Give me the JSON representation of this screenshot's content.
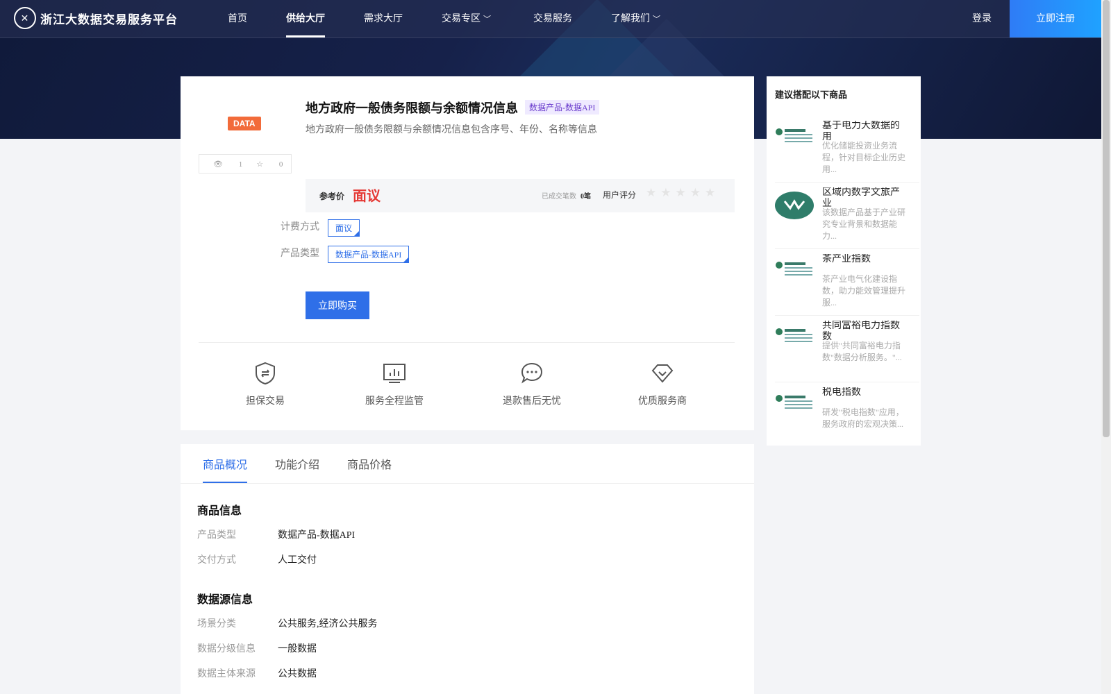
{
  "nav": {
    "logo_text": "浙江大数据交易服务平台",
    "items": [
      "首页",
      "供给大厅",
      "需求大厅",
      "交易专区",
      "交易服务",
      "了解我们"
    ],
    "login": "登录",
    "register": "立即注册"
  },
  "product": {
    "badge": "DATA",
    "views": "1",
    "favorites": "0",
    "title": "地方政府一般债务限额与余额情况信息",
    "title_tag": "数据产品-数据API",
    "subtitle": "地方政府一般债务限额与余额情况信息包含序号、年份、名称等信息",
    "price_label": "参考价",
    "price_value": "面议",
    "deals_label": "已成交笔数",
    "deals_value": "0笔",
    "rating_label": "用户评分",
    "rating_stars": 0,
    "billing_label": "计费方式",
    "billing_value": "面议",
    "type_label": "产品类型",
    "type_value": "数据产品-数据API",
    "buy_button": "立即购买"
  },
  "features": [
    "担保交易",
    "服务全程监管",
    "退款售后无忧",
    "优质服务商"
  ],
  "tabs": [
    "商品概况",
    "功能介绍",
    "商品价格"
  ],
  "info": {
    "section1_title": "商品信息",
    "section1": [
      {
        "label": "产品类型",
        "value": "数据产品-数据API"
      },
      {
        "label": "交付方式",
        "value": "人工交付"
      }
    ],
    "section2_title": "数据源信息",
    "section2": [
      {
        "label": "场景分类",
        "value": "公共服务,经济公共服务"
      },
      {
        "label": "数据分级信息",
        "value": "一般数据"
      },
      {
        "label": "数据主体来源",
        "value": "公共数据"
      }
    ]
  },
  "sidebar": {
    "title": "建议搭配以下商品",
    "items": [
      {
        "name": "基于电力大数据的用",
        "desc": "优化储能投资业务流程，针对目标企业历史用..."
      },
      {
        "name": "区域内数字文旅产业",
        "desc": "该数据产品基于产业研究专业背景和数据能力..."
      },
      {
        "name": "茶产业指数",
        "desc": "茶产业电气化建设指数，助力能效管理提升服..."
      },
      {
        "name": "共同富裕电力指数数",
        "desc": "提供\"共同富裕电力指数\"数据分析服务。\"..."
      },
      {
        "name": "税电指数",
        "desc": "研发\"税电指数\"应用，服务政府的宏观决策..."
      }
    ]
  },
  "colors": {
    "accent": "#2f6fe8",
    "price": "#e53935",
    "badge": "#f26b3a"
  }
}
